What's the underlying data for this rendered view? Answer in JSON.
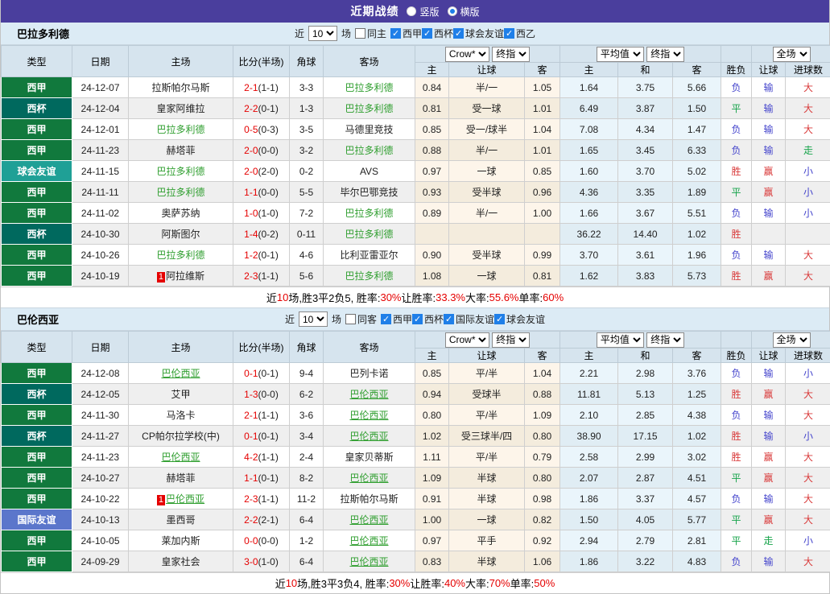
{
  "topbar": {
    "title": "近期战绩",
    "vertical_label": "竖版",
    "horizontal_label": "横版",
    "selected": "横版",
    "bar_color": "#4a3e9d"
  },
  "controls": {
    "near_label": "近",
    "games_value": "10",
    "games_unit": "场",
    "crow_select": "Crow*",
    "final_select": "终指",
    "avg_select": "平均值",
    "final2_select": "终指",
    "full_select": "全场"
  },
  "columns": {
    "type": "类型",
    "date": "日期",
    "home": "主场",
    "score": "比分(半场)",
    "corner": "角球",
    "away": "客场",
    "o_home": "主",
    "o_hcap": "让球",
    "o_away": "客",
    "a_home": "主",
    "a_draw": "和",
    "a_away": "客",
    "result": "胜负",
    "f_hcap": "让球",
    "f_goals": "进球数"
  },
  "type_colors": {
    "西甲": "#11793d",
    "西杯": "#00695e",
    "球会友谊": "#1fa096",
    "国际友谊": "#5b76cb"
  },
  "result_colors": {
    "red": "#d93a3a",
    "blue": "#4444cc",
    "green": "#16a34a"
  },
  "sections": [
    {
      "team": "巴拉多利德",
      "link_underline": false,
      "filter": {
        "same_label": "同主",
        "same_checked": false,
        "leagues": [
          "西甲",
          "西杯",
          "球会友谊",
          "西乙"
        ]
      },
      "rows": [
        {
          "type": "西甲",
          "date": "24-12-07",
          "home": "拉斯帕尔马斯",
          "home_focus": false,
          "home_badge": "",
          "score": "2-1",
          "half": "(1-1)",
          "corner": "3-3",
          "away": "巴拉多利德",
          "away_focus": true,
          "away_badge": "",
          "o1": "0.84",
          "hcap": "半/一",
          "o2": "1.05",
          "a1": "1.64",
          "a2": "3.75",
          "a3": "5.66",
          "res": "负",
          "res_c": "blue",
          "hres": "输",
          "hres_c": "blue",
          "gres": "大",
          "gres_c": "red"
        },
        {
          "type": "西杯",
          "date": "24-12-04",
          "home": "皇家阿维拉",
          "home_focus": false,
          "home_badge": "",
          "score": "2-2",
          "half": "(0-1)",
          "corner": "1-3",
          "away": "巴拉多利德",
          "away_focus": true,
          "away_badge": "",
          "o1": "0.81",
          "hcap": "受一球",
          "o2": "1.01",
          "a1": "6.49",
          "a2": "3.87",
          "a3": "1.50",
          "res": "平",
          "res_c": "green",
          "hres": "输",
          "hres_c": "blue",
          "gres": "大",
          "gres_c": "red"
        },
        {
          "type": "西甲",
          "date": "24-12-01",
          "home": "巴拉多利德",
          "home_focus": true,
          "home_badge": "",
          "score": "0-5",
          "half": "(0-3)",
          "corner": "3-5",
          "away": "马德里竞技",
          "away_focus": false,
          "away_badge": "",
          "o1": "0.85",
          "hcap": "受一/球半",
          "o2": "1.04",
          "a1": "7.08",
          "a2": "4.34",
          "a3": "1.47",
          "res": "负",
          "res_c": "blue",
          "hres": "输",
          "hres_c": "blue",
          "gres": "大",
          "gres_c": "red"
        },
        {
          "type": "西甲",
          "date": "24-11-23",
          "home": "赫塔菲",
          "home_focus": false,
          "home_badge": "",
          "score": "2-0",
          "half": "(0-0)",
          "corner": "3-2",
          "away": "巴拉多利德",
          "away_focus": true,
          "away_badge": "",
          "o1": "0.88",
          "hcap": "半/一",
          "o2": "1.01",
          "a1": "1.65",
          "a2": "3.45",
          "a3": "6.33",
          "res": "负",
          "res_c": "blue",
          "hres": "输",
          "hres_c": "blue",
          "gres": "走",
          "gres_c": "green"
        },
        {
          "type": "球会友谊",
          "date": "24-11-15",
          "home": "巴拉多利德",
          "home_focus": true,
          "home_badge": "",
          "score": "2-0",
          "half": "(2-0)",
          "corner": "0-2",
          "away": "AVS",
          "away_focus": false,
          "away_badge": "",
          "o1": "0.97",
          "hcap": "一球",
          "o2": "0.85",
          "a1": "1.60",
          "a2": "3.70",
          "a3": "5.02",
          "res": "胜",
          "res_c": "red",
          "hres": "赢",
          "hres_c": "red",
          "gres": "小",
          "gres_c": "blue"
        },
        {
          "type": "西甲",
          "date": "24-11-11",
          "home": "巴拉多利德",
          "home_focus": true,
          "home_badge": "",
          "score": "1-1",
          "half": "(0-0)",
          "corner": "5-5",
          "away": "毕尔巴鄂竞技",
          "away_focus": false,
          "away_badge": "",
          "o1": "0.93",
          "hcap": "受半球",
          "o2": "0.96",
          "a1": "4.36",
          "a2": "3.35",
          "a3": "1.89",
          "res": "平",
          "res_c": "green",
          "hres": "赢",
          "hres_c": "red",
          "gres": "小",
          "gres_c": "blue"
        },
        {
          "type": "西甲",
          "date": "24-11-02",
          "home": "奥萨苏纳",
          "home_focus": false,
          "home_badge": "",
          "score": "1-0",
          "half": "(1-0)",
          "corner": "7-2",
          "away": "巴拉多利德",
          "away_focus": true,
          "away_badge": "",
          "o1": "0.89",
          "hcap": "半/一",
          "o2": "1.00",
          "a1": "1.66",
          "a2": "3.67",
          "a3": "5.51",
          "res": "负",
          "res_c": "blue",
          "hres": "输",
          "hres_c": "blue",
          "gres": "小",
          "gres_c": "blue"
        },
        {
          "type": "西杯",
          "date": "24-10-30",
          "home": "阿斯图尔",
          "home_focus": false,
          "home_badge": "",
          "score": "1-4",
          "half": "(0-2)",
          "corner": "0-11",
          "away": "巴拉多利德",
          "away_focus": true,
          "away_badge": "",
          "o1": "",
          "hcap": "",
          "o2": "",
          "a1": "36.22",
          "a2": "14.40",
          "a3": "1.02",
          "res": "胜",
          "res_c": "red",
          "hres": "",
          "hres_c": "blue",
          "gres": "",
          "gres_c": "red"
        },
        {
          "type": "西甲",
          "date": "24-10-26",
          "home": "巴拉多利德",
          "home_focus": true,
          "home_badge": "",
          "score": "1-2",
          "half": "(0-1)",
          "corner": "4-6",
          "away": "比利亚雷亚尔",
          "away_focus": false,
          "away_badge": "",
          "o1": "0.90",
          "hcap": "受半球",
          "o2": "0.99",
          "a1": "3.70",
          "a2": "3.61",
          "a3": "1.96",
          "res": "负",
          "res_c": "blue",
          "hres": "输",
          "hres_c": "blue",
          "gres": "大",
          "gres_c": "red"
        },
        {
          "type": "西甲",
          "date": "24-10-19",
          "home": "阿拉维斯",
          "home_focus": false,
          "home_badge": "1",
          "score": "2-3",
          "half": "(1-1)",
          "corner": "5-6",
          "away": "巴拉多利德",
          "away_focus": true,
          "away_badge": "",
          "o1": "1.08",
          "hcap": "一球",
          "o2": "0.81",
          "a1": "1.62",
          "a2": "3.83",
          "a3": "5.73",
          "res": "胜",
          "res_c": "red",
          "hres": "赢",
          "hres_c": "red",
          "gres": "大",
          "gres_c": "red"
        }
      ],
      "summary": [
        {
          "text": "近",
          "red": false
        },
        {
          "text": "10",
          "red": true
        },
        {
          "text": "场,胜3平2负5, 胜率:",
          "red": false
        },
        {
          "text": "30%",
          "red": true
        },
        {
          "text": " 让胜率:",
          "red": false
        },
        {
          "text": "33.3%",
          "red": true
        },
        {
          "text": " 大率:",
          "red": false
        },
        {
          "text": "55.6%",
          "red": true
        },
        {
          "text": " 单率:",
          "red": false
        },
        {
          "text": "60%",
          "red": true
        }
      ]
    },
    {
      "team": "巴伦西亚",
      "link_underline": true,
      "filter": {
        "same_label": "同客",
        "same_checked": false,
        "leagues": [
          "西甲",
          "西杯",
          "国际友谊",
          "球会友谊"
        ]
      },
      "rows": [
        {
          "type": "西甲",
          "date": "24-12-08",
          "home": "巴伦西亚",
          "home_focus": true,
          "home_badge": "",
          "score": "0-1",
          "half": "(0-1)",
          "corner": "9-4",
          "away": "巴列卡诺",
          "away_focus": false,
          "away_badge": "",
          "o1": "0.85",
          "hcap": "平/半",
          "o2": "1.04",
          "a1": "2.21",
          "a2": "2.98",
          "a3": "3.76",
          "res": "负",
          "res_c": "blue",
          "hres": "输",
          "hres_c": "blue",
          "gres": "小",
          "gres_c": "blue"
        },
        {
          "type": "西杯",
          "date": "24-12-05",
          "home": "艾甲",
          "home_focus": false,
          "home_badge": "",
          "score": "1-3",
          "half": "(0-0)",
          "corner": "6-2",
          "away": "巴伦西亚",
          "away_focus": true,
          "away_badge": "",
          "o1": "0.94",
          "hcap": "受球半",
          "o2": "0.88",
          "a1": "11.81",
          "a2": "5.13",
          "a3": "1.25",
          "res": "胜",
          "res_c": "red",
          "hres": "赢",
          "hres_c": "red",
          "gres": "大",
          "gres_c": "red"
        },
        {
          "type": "西甲",
          "date": "24-11-30",
          "home": "马洛卡",
          "home_focus": false,
          "home_badge": "",
          "score": "2-1",
          "half": "(1-1)",
          "corner": "3-6",
          "away": "巴伦西亚",
          "away_focus": true,
          "away_badge": "",
          "o1": "0.80",
          "hcap": "平/半",
          "o2": "1.09",
          "a1": "2.10",
          "a2": "2.85",
          "a3": "4.38",
          "res": "负",
          "res_c": "blue",
          "hres": "输",
          "hres_c": "blue",
          "gres": "大",
          "gres_c": "red"
        },
        {
          "type": "西杯",
          "date": "24-11-27",
          "home": "CP帕尔拉学校(中)",
          "home_focus": false,
          "home_badge": "",
          "score": "0-1",
          "half": "(0-1)",
          "corner": "3-4",
          "away": "巴伦西亚",
          "away_focus": true,
          "away_badge": "",
          "o1": "1.02",
          "hcap": "受三球半/四",
          "o2": "0.80",
          "a1": "38.90",
          "a2": "17.15",
          "a3": "1.02",
          "res": "胜",
          "res_c": "red",
          "hres": "输",
          "hres_c": "blue",
          "gres": "小",
          "gres_c": "blue"
        },
        {
          "type": "西甲",
          "date": "24-11-23",
          "home": "巴伦西亚",
          "home_focus": true,
          "home_badge": "",
          "score": "4-2",
          "half": "(1-1)",
          "corner": "2-4",
          "away": "皇家贝蒂斯",
          "away_focus": false,
          "away_badge": "",
          "o1": "1.11",
          "hcap": "平/半",
          "o2": "0.79",
          "a1": "2.58",
          "a2": "2.99",
          "a3": "3.02",
          "res": "胜",
          "res_c": "red",
          "hres": "赢",
          "hres_c": "red",
          "gres": "大",
          "gres_c": "red"
        },
        {
          "type": "西甲",
          "date": "24-10-27",
          "home": "赫塔菲",
          "home_focus": false,
          "home_badge": "",
          "score": "1-1",
          "half": "(0-1)",
          "corner": "8-2",
          "away": "巴伦西亚",
          "away_focus": true,
          "away_badge": "",
          "o1": "1.09",
          "hcap": "半球",
          "o2": "0.80",
          "a1": "2.07",
          "a2": "2.87",
          "a3": "4.51",
          "res": "平",
          "res_c": "green",
          "hres": "赢",
          "hres_c": "red",
          "gres": "大",
          "gres_c": "red"
        },
        {
          "type": "西甲",
          "date": "24-10-22",
          "home": "巴伦西亚",
          "home_focus": true,
          "home_badge": "1",
          "score": "2-3",
          "half": "(1-1)",
          "corner": "11-2",
          "away": "拉斯帕尔马斯",
          "away_focus": false,
          "away_badge": "",
          "o1": "0.91",
          "hcap": "半球",
          "o2": "0.98",
          "a1": "1.86",
          "a2": "3.37",
          "a3": "4.57",
          "res": "负",
          "res_c": "blue",
          "hres": "输",
          "hres_c": "blue",
          "gres": "大",
          "gres_c": "red"
        },
        {
          "type": "国际友谊",
          "date": "24-10-13",
          "home": "墨西哥",
          "home_focus": false,
          "home_badge": "",
          "score": "2-2",
          "half": "(2-1)",
          "corner": "6-4",
          "away": "巴伦西亚",
          "away_focus": true,
          "away_badge": "",
          "o1": "1.00",
          "hcap": "一球",
          "o2": "0.82",
          "a1": "1.50",
          "a2": "4.05",
          "a3": "5.77",
          "res": "平",
          "res_c": "green",
          "hres": "赢",
          "hres_c": "red",
          "gres": "大",
          "gres_c": "red"
        },
        {
          "type": "西甲",
          "date": "24-10-05",
          "home": "莱加内斯",
          "home_focus": false,
          "home_badge": "",
          "score": "0-0",
          "half": "(0-0)",
          "corner": "1-2",
          "away": "巴伦西亚",
          "away_focus": true,
          "away_badge": "",
          "o1": "0.97",
          "hcap": "平手",
          "o2": "0.92",
          "a1": "2.94",
          "a2": "2.79",
          "a3": "2.81",
          "res": "平",
          "res_c": "green",
          "hres": "走",
          "hres_c": "green",
          "gres": "小",
          "gres_c": "blue"
        },
        {
          "type": "西甲",
          "date": "24-09-29",
          "home": "皇家社会",
          "home_focus": false,
          "home_badge": "",
          "score": "3-0",
          "half": "(1-0)",
          "corner": "6-4",
          "away": "巴伦西亚",
          "away_focus": true,
          "away_badge": "",
          "o1": "0.83",
          "hcap": "半球",
          "o2": "1.06",
          "a1": "1.86",
          "a2": "3.22",
          "a3": "4.83",
          "res": "负",
          "res_c": "blue",
          "hres": "输",
          "hres_c": "blue",
          "gres": "大",
          "gres_c": "red"
        }
      ],
      "summary": [
        {
          "text": "近",
          "red": false
        },
        {
          "text": "10",
          "red": true
        },
        {
          "text": "场,胜3平3负4, 胜率:",
          "red": false
        },
        {
          "text": "30%",
          "red": true
        },
        {
          "text": " 让胜率:",
          "red": false
        },
        {
          "text": "40%",
          "red": true
        },
        {
          "text": " 大率:",
          "red": false
        },
        {
          "text": "70%",
          "red": true
        },
        {
          "text": " 单率:",
          "red": false
        },
        {
          "text": "50%",
          "red": true
        }
      ]
    }
  ]
}
